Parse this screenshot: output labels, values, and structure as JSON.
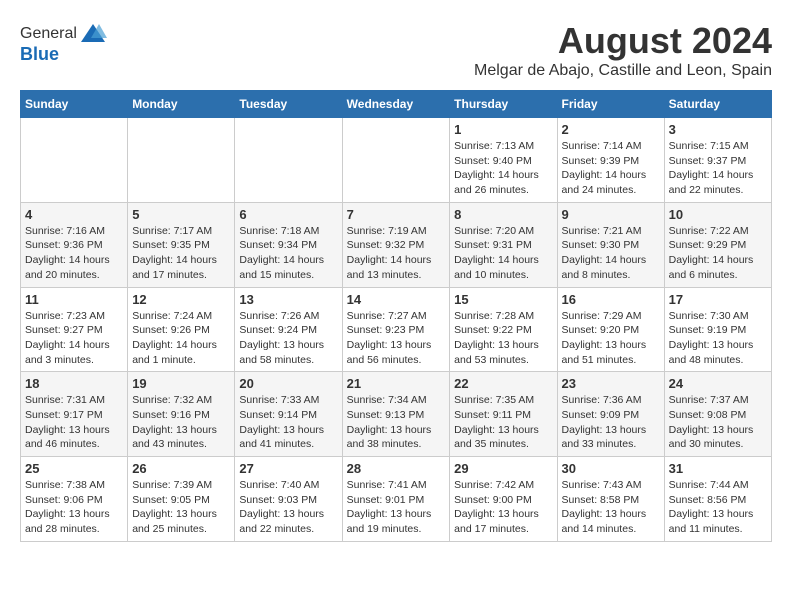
{
  "logo": {
    "general": "General",
    "blue": "Blue"
  },
  "header": {
    "month": "August 2024",
    "location": "Melgar de Abajo, Castille and Leon, Spain"
  },
  "weekdays": [
    "Sunday",
    "Monday",
    "Tuesday",
    "Wednesday",
    "Thursday",
    "Friday",
    "Saturday"
  ],
  "weeks": [
    [
      {
        "day": "",
        "info": ""
      },
      {
        "day": "",
        "info": ""
      },
      {
        "day": "",
        "info": ""
      },
      {
        "day": "",
        "info": ""
      },
      {
        "day": "1",
        "info": "Sunrise: 7:13 AM\nSunset: 9:40 PM\nDaylight: 14 hours and 26 minutes."
      },
      {
        "day": "2",
        "info": "Sunrise: 7:14 AM\nSunset: 9:39 PM\nDaylight: 14 hours and 24 minutes."
      },
      {
        "day": "3",
        "info": "Sunrise: 7:15 AM\nSunset: 9:37 PM\nDaylight: 14 hours and 22 minutes."
      }
    ],
    [
      {
        "day": "4",
        "info": "Sunrise: 7:16 AM\nSunset: 9:36 PM\nDaylight: 14 hours and 20 minutes."
      },
      {
        "day": "5",
        "info": "Sunrise: 7:17 AM\nSunset: 9:35 PM\nDaylight: 14 hours and 17 minutes."
      },
      {
        "day": "6",
        "info": "Sunrise: 7:18 AM\nSunset: 9:34 PM\nDaylight: 14 hours and 15 minutes."
      },
      {
        "day": "7",
        "info": "Sunrise: 7:19 AM\nSunset: 9:32 PM\nDaylight: 14 hours and 13 minutes."
      },
      {
        "day": "8",
        "info": "Sunrise: 7:20 AM\nSunset: 9:31 PM\nDaylight: 14 hours and 10 minutes."
      },
      {
        "day": "9",
        "info": "Sunrise: 7:21 AM\nSunset: 9:30 PM\nDaylight: 14 hours and 8 minutes."
      },
      {
        "day": "10",
        "info": "Sunrise: 7:22 AM\nSunset: 9:29 PM\nDaylight: 14 hours and 6 minutes."
      }
    ],
    [
      {
        "day": "11",
        "info": "Sunrise: 7:23 AM\nSunset: 9:27 PM\nDaylight: 14 hours and 3 minutes."
      },
      {
        "day": "12",
        "info": "Sunrise: 7:24 AM\nSunset: 9:26 PM\nDaylight: 14 hours and 1 minute."
      },
      {
        "day": "13",
        "info": "Sunrise: 7:26 AM\nSunset: 9:24 PM\nDaylight: 13 hours and 58 minutes."
      },
      {
        "day": "14",
        "info": "Sunrise: 7:27 AM\nSunset: 9:23 PM\nDaylight: 13 hours and 56 minutes."
      },
      {
        "day": "15",
        "info": "Sunrise: 7:28 AM\nSunset: 9:22 PM\nDaylight: 13 hours and 53 minutes."
      },
      {
        "day": "16",
        "info": "Sunrise: 7:29 AM\nSunset: 9:20 PM\nDaylight: 13 hours and 51 minutes."
      },
      {
        "day": "17",
        "info": "Sunrise: 7:30 AM\nSunset: 9:19 PM\nDaylight: 13 hours and 48 minutes."
      }
    ],
    [
      {
        "day": "18",
        "info": "Sunrise: 7:31 AM\nSunset: 9:17 PM\nDaylight: 13 hours and 46 minutes."
      },
      {
        "day": "19",
        "info": "Sunrise: 7:32 AM\nSunset: 9:16 PM\nDaylight: 13 hours and 43 minutes."
      },
      {
        "day": "20",
        "info": "Sunrise: 7:33 AM\nSunset: 9:14 PM\nDaylight: 13 hours and 41 minutes."
      },
      {
        "day": "21",
        "info": "Sunrise: 7:34 AM\nSunset: 9:13 PM\nDaylight: 13 hours and 38 minutes."
      },
      {
        "day": "22",
        "info": "Sunrise: 7:35 AM\nSunset: 9:11 PM\nDaylight: 13 hours and 35 minutes."
      },
      {
        "day": "23",
        "info": "Sunrise: 7:36 AM\nSunset: 9:09 PM\nDaylight: 13 hours and 33 minutes."
      },
      {
        "day": "24",
        "info": "Sunrise: 7:37 AM\nSunset: 9:08 PM\nDaylight: 13 hours and 30 minutes."
      }
    ],
    [
      {
        "day": "25",
        "info": "Sunrise: 7:38 AM\nSunset: 9:06 PM\nDaylight: 13 hours and 28 minutes."
      },
      {
        "day": "26",
        "info": "Sunrise: 7:39 AM\nSunset: 9:05 PM\nDaylight: 13 hours and 25 minutes."
      },
      {
        "day": "27",
        "info": "Sunrise: 7:40 AM\nSunset: 9:03 PM\nDaylight: 13 hours and 22 minutes."
      },
      {
        "day": "28",
        "info": "Sunrise: 7:41 AM\nSunset: 9:01 PM\nDaylight: 13 hours and 19 minutes."
      },
      {
        "day": "29",
        "info": "Sunrise: 7:42 AM\nSunset: 9:00 PM\nDaylight: 13 hours and 17 minutes."
      },
      {
        "day": "30",
        "info": "Sunrise: 7:43 AM\nSunset: 8:58 PM\nDaylight: 13 hours and 14 minutes."
      },
      {
        "day": "31",
        "info": "Sunrise: 7:44 AM\nSunset: 8:56 PM\nDaylight: 13 hours and 11 minutes."
      }
    ]
  ]
}
